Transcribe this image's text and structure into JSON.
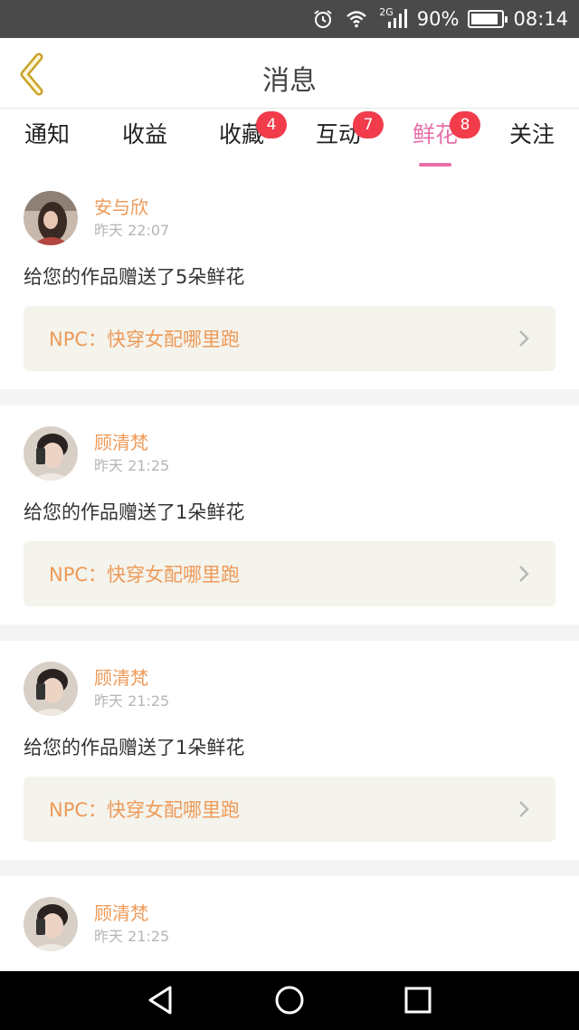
{
  "status_bar": {
    "network": "2G",
    "battery": "90%",
    "battery_level": 0.9,
    "time": "08:14"
  },
  "header": {
    "title": "消息"
  },
  "tabs": [
    {
      "label": "通知",
      "badge": null,
      "active": false
    },
    {
      "label": "收益",
      "badge": null,
      "active": false
    },
    {
      "label": "收藏",
      "badge": "4",
      "active": false
    },
    {
      "label": "互动",
      "badge": "7",
      "active": false
    },
    {
      "label": "鲜花",
      "badge": "8",
      "active": true
    },
    {
      "label": "关注",
      "badge": null,
      "active": false
    }
  ],
  "feed": [
    {
      "user": "安与欣",
      "time": "昨天 22:07",
      "message": "给您的作品赠送了5朵鲜花",
      "work": "NPC：快穿女配哪里跑"
    },
    {
      "user": "顾清梵",
      "time": "昨天 21:25",
      "message": "给您的作品赠送了1朵鲜花",
      "work": "NPC：快穿女配哪里跑"
    },
    {
      "user": "顾清梵",
      "time": "昨天 21:25",
      "message": "给您的作品赠送了1朵鲜花",
      "work": "NPC：快穿女配哪里跑"
    },
    {
      "user": "顾清梵",
      "time": "昨天 21:25",
      "message": "",
      "work": ""
    }
  ],
  "colors": {
    "accent_pink": "#e56ea8",
    "username_orange": "#ee9a58",
    "badge_red": "#f23c4c",
    "link_bg": "#f4f3ec"
  },
  "icons": [
    "alarm-icon",
    "wifi-icon",
    "signal-icon",
    "battery-icon",
    "back-chevron-icon",
    "chevron-right-icon",
    "nav-back-icon",
    "nav-home-icon",
    "nav-recents-icon"
  ]
}
